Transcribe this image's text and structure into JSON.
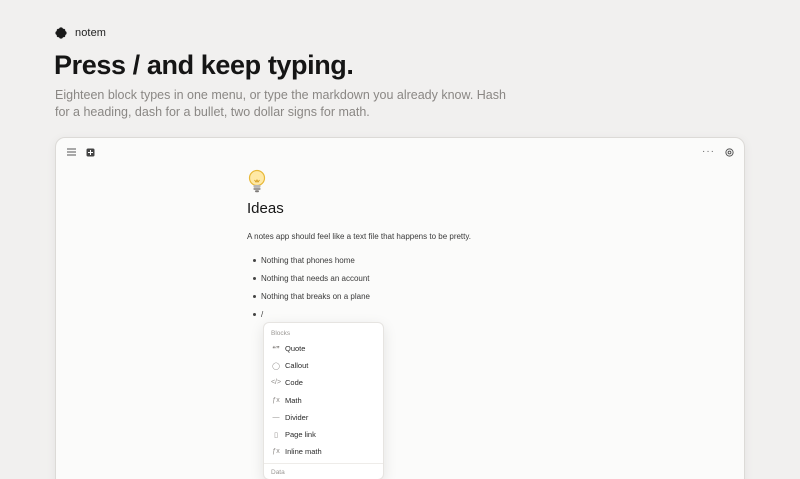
{
  "brand": {
    "name": "notem",
    "logo_icon": "flower-logo-icon"
  },
  "hero": {
    "headline": "Press / and keep typing.",
    "subline": "Eighteen block types in one menu, or type the markdown you already know. Hash for a heading, dash for a bullet, two dollar signs for math."
  },
  "toolbar": {
    "left_icons": [
      "menu-icon",
      "new-page-icon"
    ],
    "more_label": "···",
    "right_icons": [
      "settings-icon"
    ]
  },
  "doc": {
    "emoji_icon": "lightbulb-icon",
    "title": "Ideas",
    "paragraph": "A notes app should feel like a text file that happens to be pretty.",
    "bullets": [
      "Nothing that phones home",
      "Nothing that needs an account",
      "Nothing that breaks on a plane",
      "/"
    ]
  },
  "slash_menu": {
    "group_label": "Blocks",
    "items": [
      {
        "label": "Quote",
        "icon": "quote-icon",
        "glyph": "❝❞"
      },
      {
        "label": "Callout",
        "icon": "callout-icon",
        "glyph": "◯"
      },
      {
        "label": "Code",
        "icon": "code-icon",
        "glyph": "</>"
      },
      {
        "label": "Math",
        "icon": "math-icon",
        "glyph": "ƒx"
      },
      {
        "label": "Divider",
        "icon": "divider-icon",
        "glyph": "—"
      },
      {
        "label": "Page link",
        "icon": "page-link-icon",
        "glyph": "▯"
      },
      {
        "label": "Inline math",
        "icon": "inline-math-icon",
        "glyph": "ƒx"
      }
    ],
    "next_group_label": "Data"
  }
}
